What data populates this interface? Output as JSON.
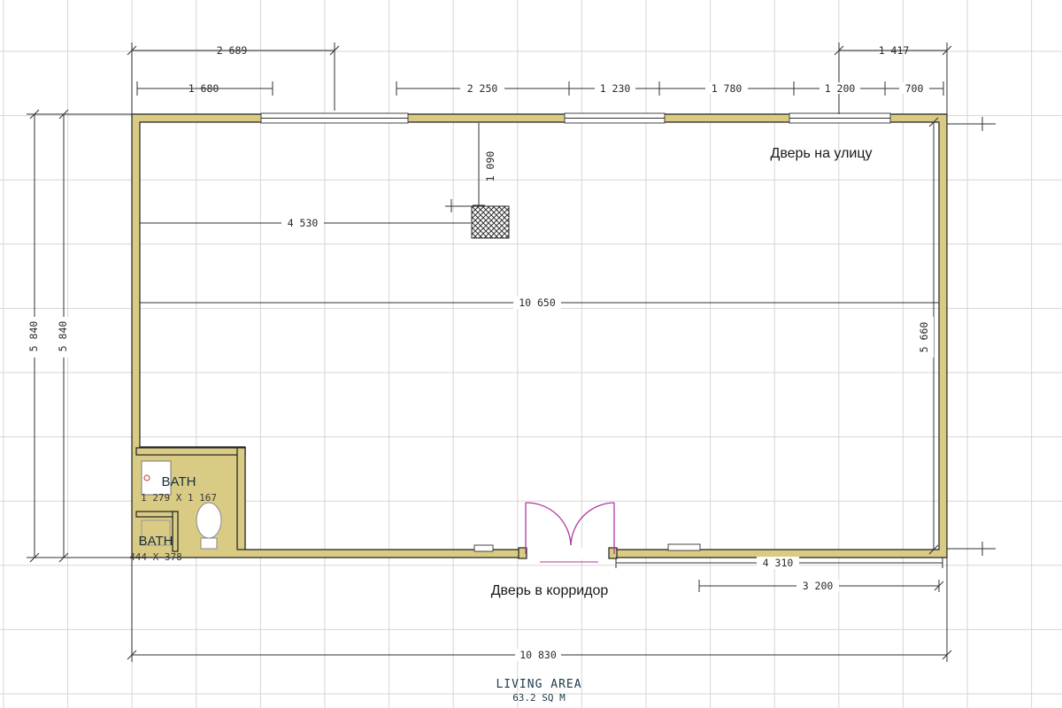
{
  "dimensions": {
    "top_left_outer": "2 689",
    "top_right_outer": "1 417",
    "top_seg_1": "1 680",
    "top_seg_2": "2 250",
    "top_seg_3": "1 230",
    "top_seg_4": "1 780",
    "top_seg_5": "1 200",
    "top_seg_6": "700",
    "column_offset_vertical": "1 090",
    "column_offset_horizontal": "4 530",
    "inner_width": "10 650",
    "left_outer_height_1": "5 840",
    "left_outer_height_2": "5 840",
    "right_inner_height": "5 660",
    "bottom_right_1": "4 310",
    "bottom_right_2": "3 200",
    "overall_width": "10 830"
  },
  "labels": {
    "door_street": "Дверь на улицу",
    "door_corridor": "Дверь в корридор",
    "bath_1_name": "BATH",
    "bath_1_size": "1 279 X 1 167",
    "bath_2_name": "BATH",
    "bath_2_size": "444 X 378",
    "area_name": "LIVING AREA",
    "area_value": "63.2 SQ M"
  },
  "colors": {
    "wall_fill": "#d9cb84",
    "door_swing": "#b03aa0",
    "grid": "#d6d6d6"
  }
}
